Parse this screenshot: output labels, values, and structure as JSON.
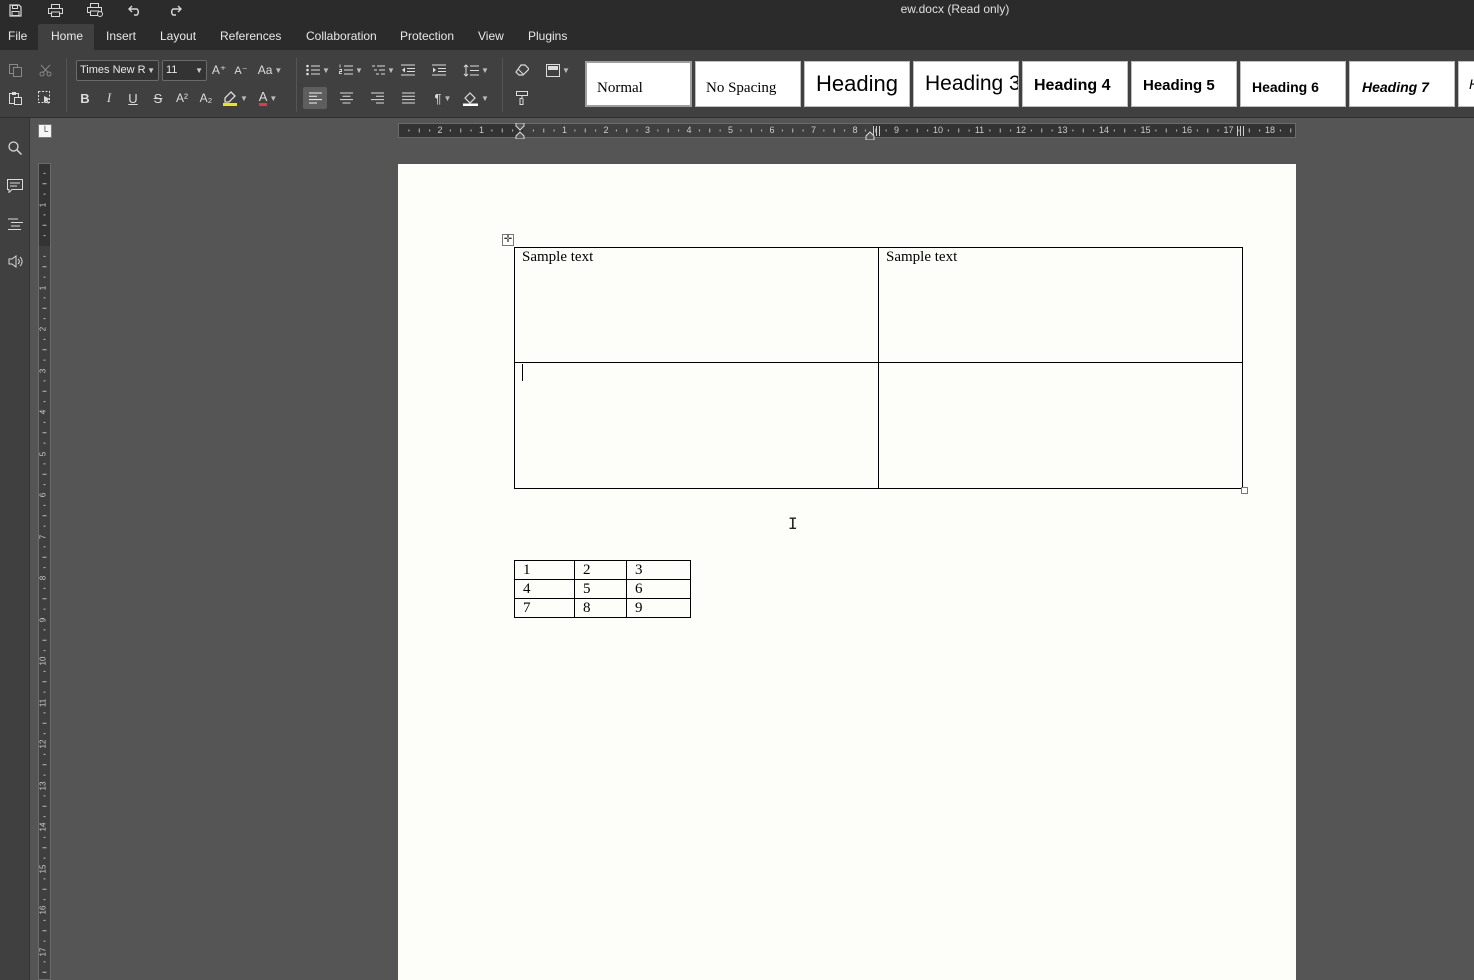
{
  "window": {
    "title": "ew.docx (Read only)"
  },
  "quick_access": {
    "save_icon": "floppy-disk-icon",
    "print_icon": "printer-icon",
    "quick_print_icon": "quick-print-icon",
    "undo_icon": "undo-icon",
    "redo_icon": "redo-icon"
  },
  "menu": {
    "items": [
      "File",
      "Home",
      "Insert",
      "Layout",
      "References",
      "Collaboration",
      "Protection",
      "View",
      "Plugins"
    ],
    "active": "Home"
  },
  "toolbar": {
    "font_name": "Times New R",
    "font_size": "11",
    "grow_font": "A⁺",
    "shrink_font": "A⁻",
    "change_case": "Aa",
    "bold": "B",
    "italic": "I",
    "underline": "U",
    "strikethrough": "S",
    "superscript": "A²",
    "subscript": "A₂",
    "font_color_letter": "A",
    "paragraph_mark": "¶",
    "highlight_color": "#f5e600",
    "font_color": "#e33b3b"
  },
  "styles": [
    {
      "name": "Normal",
      "selected": true
    },
    {
      "name": "No Spacing"
    },
    {
      "name": "Heading"
    },
    {
      "name": "Heading 3"
    },
    {
      "name": "Heading 4"
    },
    {
      "name": "Heading 5"
    },
    {
      "name": "Heading 6"
    },
    {
      "name": "Heading 7"
    },
    {
      "name": "H"
    }
  ],
  "leftbar": {
    "search_icon": "search-icon",
    "comments_icon": "comment-icon",
    "navigation_icon": "headings-icon",
    "speech_icon": "speaker-icon"
  },
  "document": {
    "table1": {
      "rows": [
        [
          "Sample text",
          "Sample text"
        ],
        [
          "",
          ""
        ]
      ]
    },
    "table2": {
      "rows": [
        [
          "1",
          "2",
          "3"
        ],
        [
          "4",
          "5",
          "6"
        ],
        [
          "7",
          "8",
          "9"
        ]
      ]
    }
  },
  "rulers": {
    "horizontal_labels": [
      "2",
      "1",
      "1",
      "2",
      "3",
      "4",
      "5",
      "6",
      "7",
      "8",
      "9",
      "10",
      "11",
      "12",
      "13",
      "14",
      "15",
      "16",
      "17",
      "18"
    ],
    "vertical_labels": [
      "1",
      "1",
      "2",
      "3",
      "4",
      "5",
      "6",
      "7",
      "8",
      "9",
      "10",
      "11",
      "12",
      "13",
      "14",
      "15",
      "16",
      "17"
    ]
  }
}
